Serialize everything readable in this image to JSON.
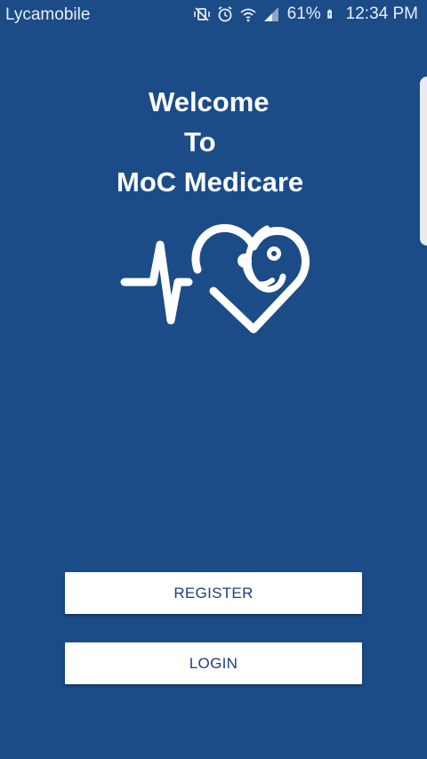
{
  "status_bar": {
    "carrier": "Lycamobile",
    "battery_percent": "61%",
    "time": "12:34 PM",
    "icons": [
      "mute-vibrate-icon",
      "alarm-icon",
      "wifi-icon",
      "signal-icon",
      "battery-charging-icon"
    ]
  },
  "welcome": {
    "line1": "Welcome",
    "line2": "To",
    "line3": "MoC Medicare"
  },
  "logo": {
    "name": "heartbeat-stethoscope-heart-logo",
    "color": "#ffffff"
  },
  "buttons": {
    "register_label": "REGISTER",
    "login_label": "LOGIN"
  },
  "colors": {
    "background": "#1b4c87",
    "button_background": "#ffffff",
    "button_text": "#1f3e7a"
  }
}
